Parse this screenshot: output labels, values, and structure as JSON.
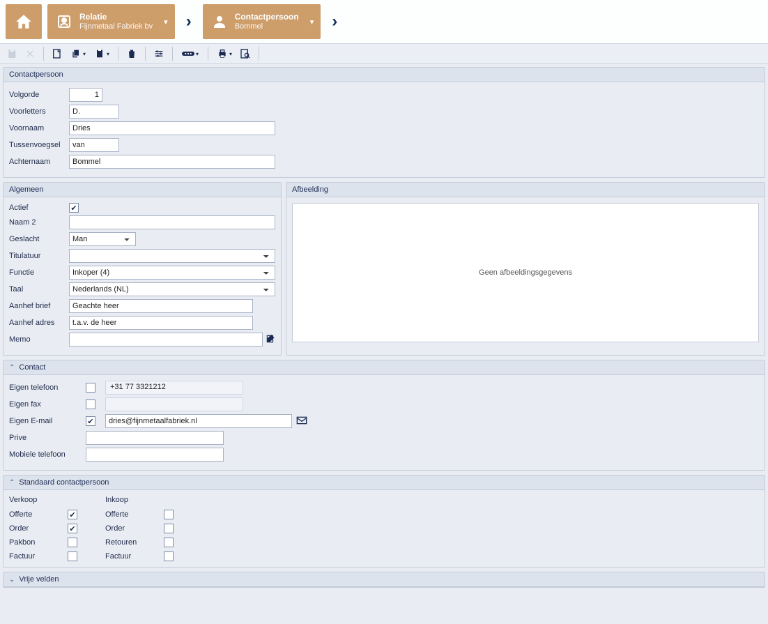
{
  "breadcrumb": {
    "relatie": {
      "title": "Relatie",
      "sub": "Fijnmetaal Fabriek bv"
    },
    "contact": {
      "title": "Contactpersoon",
      "sub": "Bommel"
    }
  },
  "panels": {
    "main": "Contactpersoon",
    "algemeen": "Algemeen",
    "afbeelding": "Afbeelding",
    "contact": "Contact",
    "standaard": "Standaard contactpersoon",
    "vrije": "Vrije velden"
  },
  "labels": {
    "volgorde": "Volgorde",
    "voorletters": "Voorletters",
    "voornaam": "Voornaam",
    "tussenvoegsel": "Tussenvoegsel",
    "achternaam": "Achternaam",
    "actief": "Actief",
    "naam2": "Naam 2",
    "geslacht": "Geslacht",
    "titulatuur": "Titulatuur",
    "functie": "Functie",
    "taal": "Taal",
    "aanhef_brief": "Aanhef brief",
    "aanhef_adres": "Aanhef adres",
    "memo": "Memo",
    "eigen_tel": "Eigen telefoon",
    "eigen_fax": "Eigen fax",
    "eigen_email": "Eigen E-mail",
    "prive": "Prive",
    "mobiel": "Mobiele telefoon",
    "verkoop": "Verkoop",
    "inkoop": "Inkoop",
    "offerte": "Offerte",
    "order": "Order",
    "pakbon": "Pakbon",
    "retouren": "Retouren",
    "factuur": "Factuur",
    "noimage": "Geen afbeeldingsgegevens"
  },
  "values": {
    "volgorde": "1",
    "voorletters": "D.",
    "voornaam": "Dries",
    "tussenvoegsel": "van",
    "achternaam": "Bommel",
    "actief": true,
    "naam2": "",
    "geslacht": "Man",
    "titulatuur": "",
    "functie": "Inkoper (4)",
    "taal": "Nederlands (NL)",
    "aanhef_brief": "Geachte heer",
    "aanhef_adres": "t.a.v. de heer",
    "memo": "",
    "eigen_tel_chk": false,
    "eigen_tel": "+31 77 3321212",
    "eigen_fax_chk": false,
    "eigen_fax": "",
    "eigen_email_chk": true,
    "eigen_email": "dries@fijnmetaalfabriek.nl",
    "prive": "",
    "mobiel": "",
    "verkoop": {
      "offerte": true,
      "order": true,
      "pakbon": false,
      "factuur": false
    },
    "inkoop": {
      "offerte": false,
      "order": false,
      "retouren": false,
      "factuur": false
    }
  }
}
